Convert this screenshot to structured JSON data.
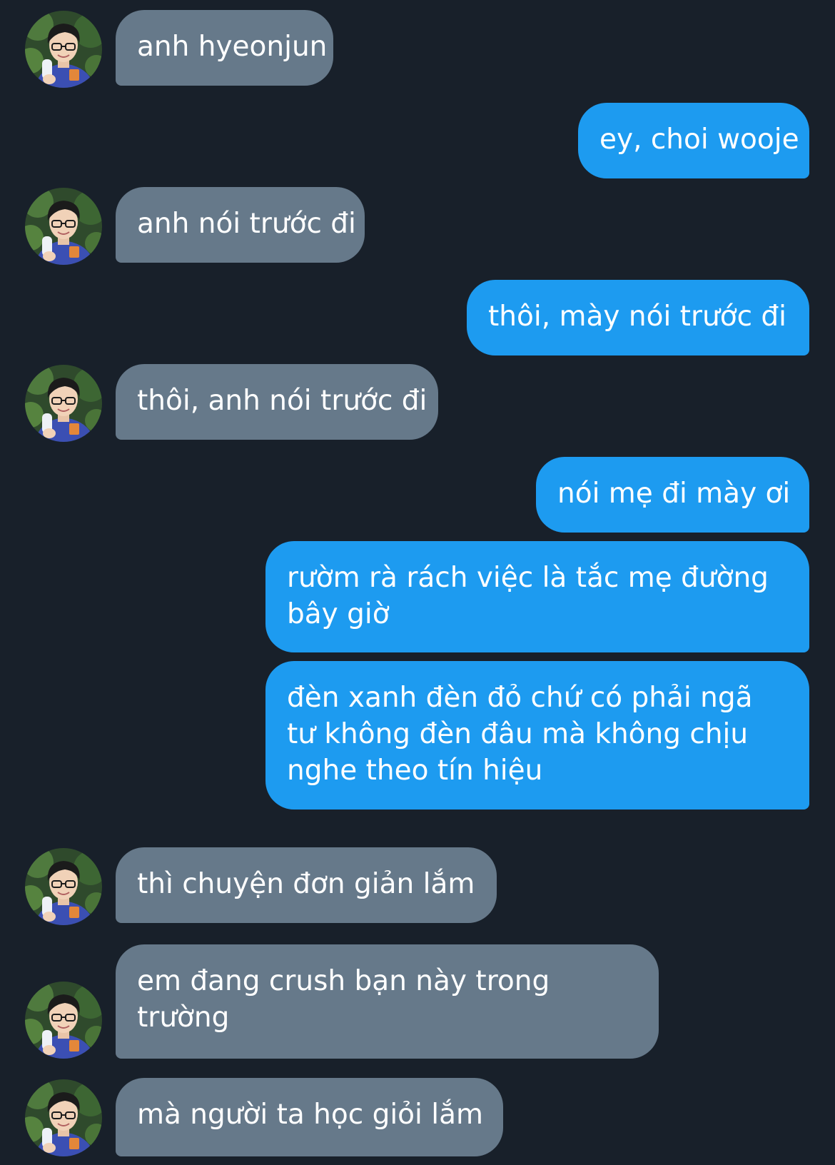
{
  "conversation": {
    "contact": {
      "avatar_icon": "profile-photo-boy-with-popsicle"
    },
    "colors": {
      "background": "#18202a",
      "incoming_bubble": "#66798a",
      "outgoing_bubble": "#1d9bf0",
      "text": "#ffffff"
    },
    "messages": [
      {
        "direction": "incoming",
        "text": "anh hyeonjun"
      },
      {
        "direction": "outgoing",
        "text": "ey, choi wooje"
      },
      {
        "direction": "incoming",
        "text": "anh nói trước đi"
      },
      {
        "direction": "outgoing",
        "text": "thôi, mày nói trước đi"
      },
      {
        "direction": "incoming",
        "text": "thôi, anh nói trước đi"
      },
      {
        "direction": "outgoing",
        "text": "nói mẹ đi mày ơi"
      },
      {
        "direction": "outgoing",
        "text": "rườm rà rách việc là tắc mẹ đường bây giờ"
      },
      {
        "direction": "outgoing",
        "text": "đèn xanh đèn đỏ chứ có phải ngã tư không đèn đâu mà không chịu nghe theo tín hiệu"
      },
      {
        "direction": "incoming",
        "text": "thì chuyện đơn giản lắm"
      },
      {
        "direction": "incoming",
        "text": "em đang crush bạn này trong trường"
      },
      {
        "direction": "incoming",
        "text": "mà người ta học giỏi lắm"
      }
    ]
  }
}
